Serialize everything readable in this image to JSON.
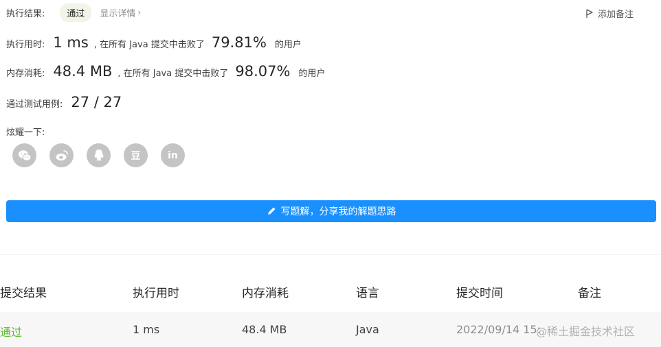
{
  "result": {
    "label": "执行结果:",
    "status": "通过",
    "detail_link": "显示详情",
    "add_note": "添加备注"
  },
  "runtime": {
    "label": "执行用时:",
    "value": "1 ms",
    "beat_text": ", 在所有 Java 提交中击败了",
    "percent": "79.81%",
    "tail": "的用户"
  },
  "memory": {
    "label": "内存消耗:",
    "value": "48.4 MB",
    "beat_text": ", 在所有 Java 提交中击败了",
    "percent": "98.07%",
    "tail": "的用户"
  },
  "tests": {
    "label": "通过测试用例:",
    "value": "27 / 27"
  },
  "share": {
    "label": "炫耀一下:",
    "icons": [
      "wechat-icon",
      "weibo-icon",
      "qq-icon",
      "douban-icon",
      "linkedin-icon"
    ],
    "douban_glyph": "豆",
    "linkedin_glyph": "in"
  },
  "write_solution": "写题解，分享我的解题思路",
  "table": {
    "headers": [
      "提交结果",
      "执行用时",
      "内存消耗",
      "语言",
      "提交时间",
      "备注"
    ],
    "rows": [
      {
        "status": "通过",
        "runtime": "1 ms",
        "memory": "48.4 MB",
        "language": "Java",
        "time": "2022/09/14 15:"
      }
    ]
  },
  "watermark": "@稀土掘金技术社区",
  "colors": {
    "accent": "#1a90ff",
    "pass_green": "#5cb82b",
    "icon_gray": "#c4c4c4"
  }
}
